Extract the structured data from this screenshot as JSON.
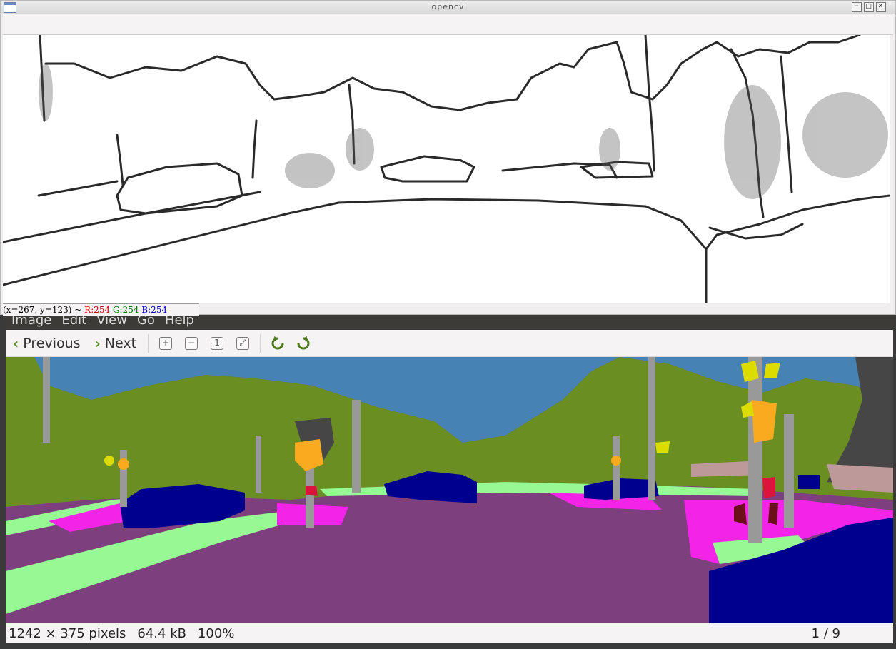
{
  "opencv_window": {
    "title": "opencv",
    "status": {
      "coords": "(x=267, y=123) ~",
      "r": "R:254",
      "g": "G:254",
      "b": "B:254"
    }
  },
  "viewer": {
    "menu": [
      "Image",
      "Edit",
      "View",
      "Go",
      "Help"
    ],
    "toolbar": {
      "previous_label": "Previous",
      "next_label": "Next"
    },
    "status": {
      "dimensions": "1242 × 375 pixels",
      "size": "64.4 kB",
      "zoom": "100%",
      "position": "1 / 9"
    }
  },
  "colors": {
    "road": "#7d3f7e",
    "sidewalk": "#97f993",
    "sky": "#4682b4",
    "vegetation": "#6b8e23",
    "car": "#00008e",
    "pole": "#999999",
    "building": "#464646",
    "sign": "#dcdc00",
    "light": "#faaa1e",
    "terrain_pink": "#f423e8",
    "person": "#dc143c",
    "wall": "#be9999",
    "accent_green": "#5f8f2a"
  },
  "icons": [
    "zoom-in-icon",
    "zoom-out-icon",
    "zoom-normal-icon",
    "zoom-fit-icon",
    "rotate-left-icon",
    "rotate-right-icon"
  ]
}
